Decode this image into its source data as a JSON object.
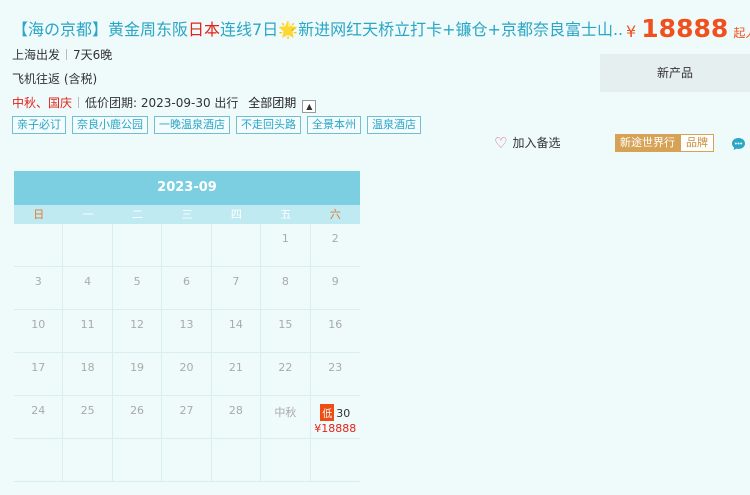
{
  "product": {
    "title_part1": "【海の京都】黄金周东阪",
    "title_highlight": "日本",
    "title_part2": "连线7日🌟新进网红天桥立打卡+镰仓+京都奈良富士山...",
    "price_symbol": "¥",
    "price": "18888",
    "price_suffix": "起人/",
    "departure": "上海出发",
    "duration": "7天6晚",
    "transport": "飞机往返 (含税)",
    "holiday": "中秋、国庆",
    "low_price_date": "低价团期: 2023-09-30 出行",
    "all_dates_label": "全部团期",
    "new_product_label": "新产品",
    "tags": [
      "亲子必订",
      "奈良小鹿公园",
      "一晚温泉酒店",
      "不走回头路",
      "全景本州",
      "温泉酒店"
    ],
    "favorite_label": "加入备选",
    "brand_name": "新途世界行",
    "brand_label": "品牌"
  },
  "calendar": {
    "month": "2023-09",
    "weekdays": [
      "日",
      "一",
      "二",
      "三",
      "四",
      "五",
      "六"
    ],
    "cells": [
      "",
      "",
      "",
      "",
      "",
      "1",
      "2",
      "3",
      "4",
      "5",
      "6",
      "7",
      "8",
      "9",
      "10",
      "11",
      "12",
      "13",
      "14",
      "15",
      "16",
      "17",
      "18",
      "19",
      "20",
      "21",
      "22",
      "23",
      "24",
      "25",
      "26",
      "27",
      "28",
      "中秋",
      "30",
      "",
      "",
      "",
      "",
      "",
      "",
      ""
    ],
    "low_badge": "低",
    "low_day_price": "¥18888"
  },
  "colors": {
    "title": "#2aa6c6",
    "price": "#f0501e",
    "holiday": "#e2231a",
    "calendar_header": "#7bcfe0"
  }
}
